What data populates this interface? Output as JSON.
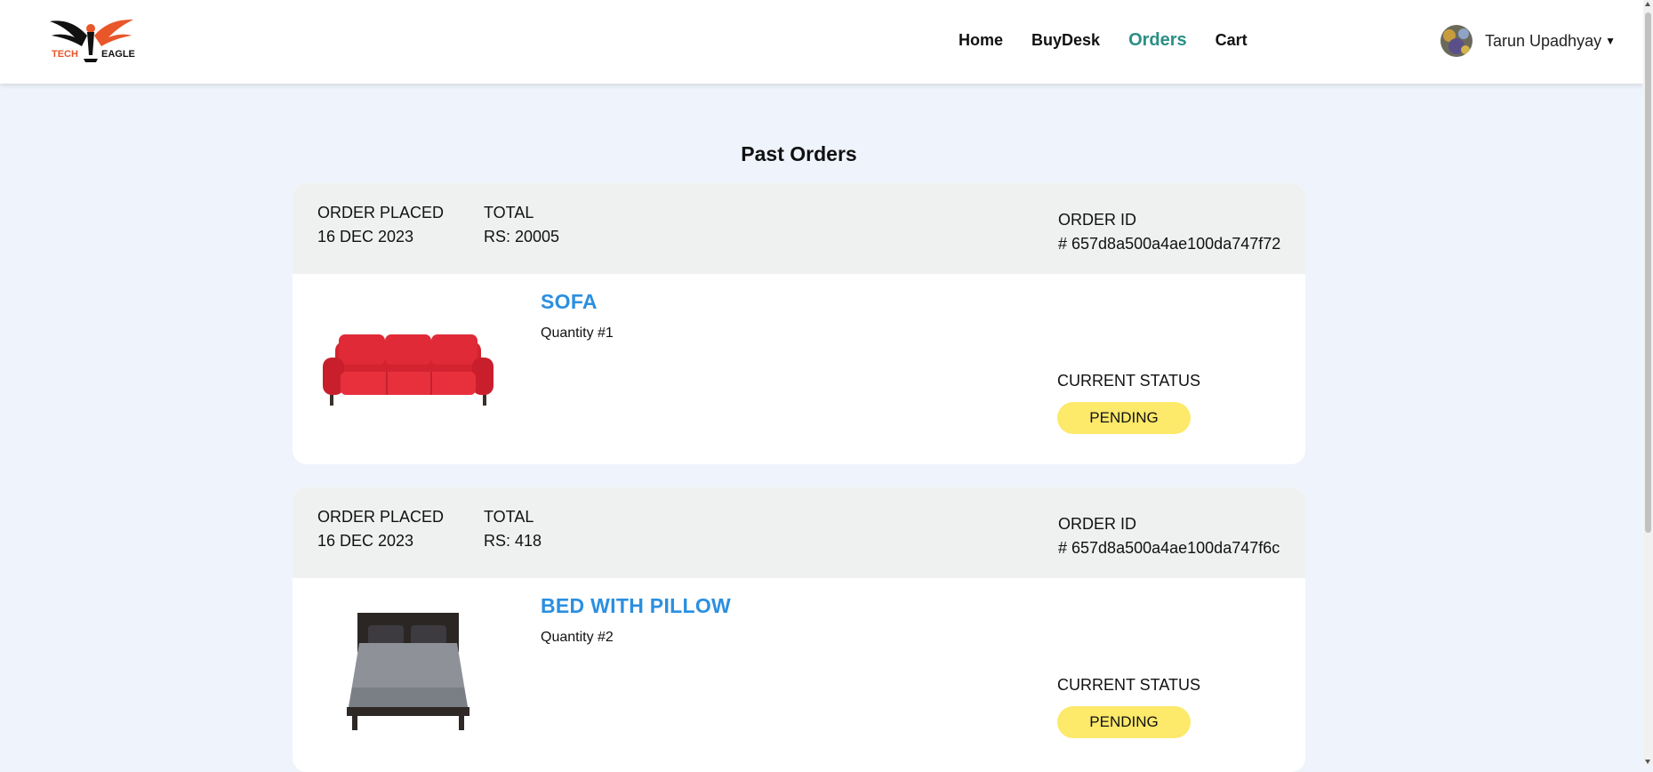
{
  "brand": {
    "logo_left": "TECH",
    "logo_right": "EAGLE",
    "accent": "#e8562a"
  },
  "nav": [
    {
      "label": "Home"
    },
    {
      "label": "BuyDesk"
    },
    {
      "label": "Orders",
      "active": true
    },
    {
      "label": "Cart"
    }
  ],
  "user": {
    "name": "Tarun Upadhyay",
    "icon": "chevron-down-icon"
  },
  "page_title": "Past Orders",
  "orders": [
    {
      "placed_label": "ORDER PLACED",
      "placed_date": "16 DEC 2023",
      "total_label": "TOTAL",
      "total_value": "RS: 20005",
      "id_label": "ORDER ID",
      "id_value": "# 657d8a500a4ae100da747f72",
      "product_name": "SOFA",
      "quantity": "Quantity #1",
      "status_label": "CURRENT STATUS",
      "status": "PENDING"
    },
    {
      "placed_label": "ORDER PLACED",
      "placed_date": "16 DEC 2023",
      "total_label": "TOTAL",
      "total_value": "RS: 418",
      "id_label": "ORDER ID",
      "id_value": "# 657d8a500a4ae100da747f6c",
      "product_name": "BED WITH PILLOW",
      "quantity": "Quantity #2",
      "status_label": "CURRENT STATUS",
      "status": "PENDING"
    }
  ],
  "colors": {
    "active_nav": "#2a8f86",
    "product_name": "#2b8fe0",
    "status_pending": "#fde96a",
    "background": "#eff4fc"
  }
}
